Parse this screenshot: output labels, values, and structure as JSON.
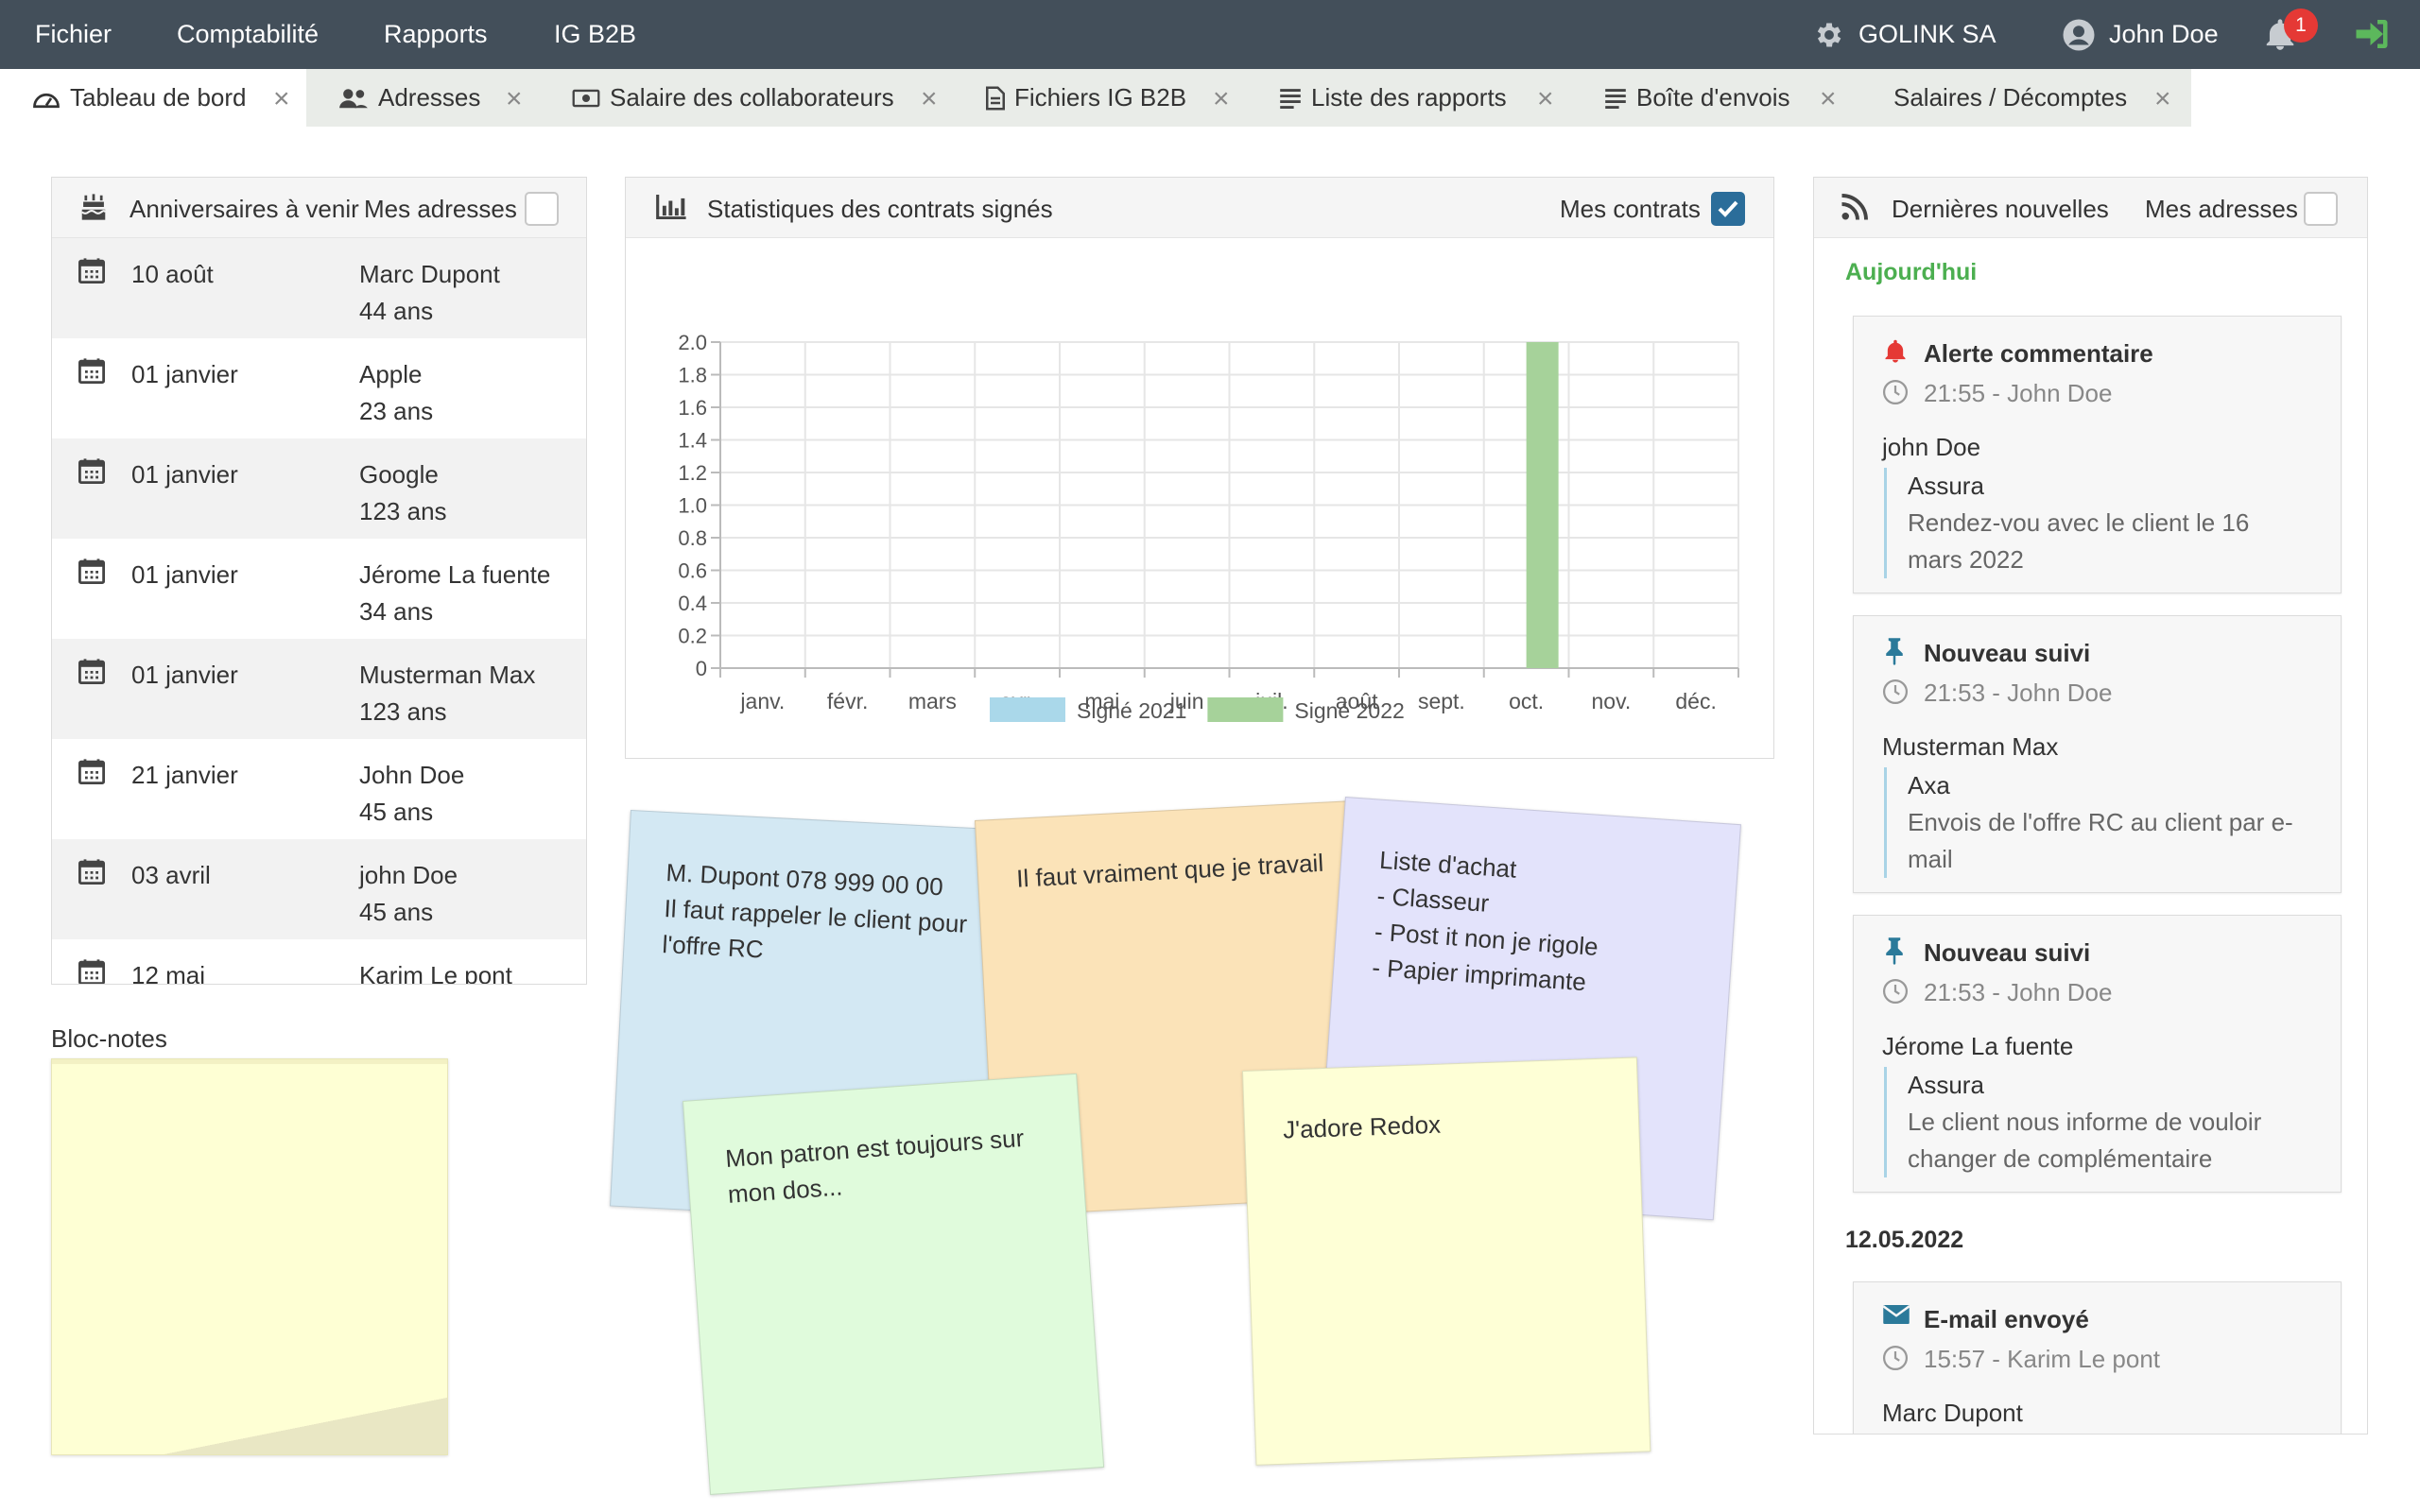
{
  "menu": {
    "items": [
      "Fichier",
      "Comptabilité",
      "Rapports",
      "IG B2B"
    ]
  },
  "header": {
    "company": "GOLINK SA",
    "user": "John Doe",
    "notifications_count": "1"
  },
  "tabs": [
    {
      "label": "Tableau de bord",
      "icon": "dashboard-icon",
      "active": true
    },
    {
      "label": "Adresses",
      "icon": "users-icon"
    },
    {
      "label": "Salaire des collaborateurs",
      "icon": "money-icon"
    },
    {
      "label": "Fichiers IG B2B",
      "icon": "file-icon"
    },
    {
      "label": "Liste des rapports",
      "icon": "list-icon"
    },
    {
      "label": "Boîte d'envois",
      "icon": "list-icon"
    },
    {
      "label": "Salaires / Décomptes",
      "icon": ""
    }
  ],
  "birthdays": {
    "title": "Anniversaires à venir",
    "filter_label": "Mes adresses",
    "filter_checked": false,
    "rows": [
      {
        "date": "10 août",
        "name": "Marc Dupont",
        "age": "44 ans"
      },
      {
        "date": "01 janvier",
        "name": "Apple",
        "age": "23 ans"
      },
      {
        "date": "01 janvier",
        "name": "Google",
        "age": "123 ans"
      },
      {
        "date": "01 janvier",
        "name": "Jérome La fuente",
        "age": "34 ans"
      },
      {
        "date": "01 janvier",
        "name": "Musterman Max",
        "age": "123 ans"
      },
      {
        "date": "21 janvier",
        "name": "John Doe",
        "age": "45 ans"
      },
      {
        "date": "03 avril",
        "name": "john Doe",
        "age": "45 ans"
      },
      {
        "date": "12 mai",
        "name": "Karim Le pont",
        "age": ""
      }
    ]
  },
  "notepad": {
    "title": "Bloc-notes",
    "content": ""
  },
  "stats": {
    "title": "Statistiques des contrats signés",
    "filter_label": "Mes contrats",
    "filter_checked": true
  },
  "chart_data": {
    "type": "bar",
    "categories": [
      "janv.",
      "févr.",
      "mars",
      "avr.",
      "mai",
      "juin",
      "juil.",
      "août",
      "sept.",
      "oct.",
      "nov.",
      "déc."
    ],
    "series": [
      {
        "name": "Signé 2021",
        "color": "#aad8ea",
        "values": [
          0,
          0,
          0,
          0,
          0,
          0,
          0,
          0,
          0,
          0,
          0,
          0
        ]
      },
      {
        "name": "Signé 2022",
        "color": "#a6d29a",
        "values": [
          0,
          0,
          0,
          0,
          0,
          0,
          0,
          0,
          0,
          2,
          0,
          0
        ]
      }
    ],
    "ylim": [
      0,
      2
    ],
    "yticks": [
      "0",
      "0.2",
      "0.4",
      "0.6",
      "0.8",
      "1.0",
      "1.2",
      "1.4",
      "1.6",
      "1.8",
      "2.0"
    ],
    "legend": "bottom",
    "grid": true
  },
  "notes": [
    {
      "lines": [
        "M. Dupont 078 999 00 00",
        "Il faut rappeler le client pour",
        "l'offre RC"
      ],
      "color": "#d3e8f3"
    },
    {
      "lines": [
        "Il faut vraiment que je travail"
      ],
      "color": "#fbe3b8"
    },
    {
      "lines": [
        "Liste d'achat",
        "- Classeur",
        "- Post it non je rigole",
        "- Papier imprimante"
      ],
      "color": "#e3e3fb"
    },
    {
      "lines": [
        "Mon patron est toujours sur",
        "mon dos..."
      ],
      "color": "#e0fbdc"
    },
    {
      "lines": [
        "J'adore Redox"
      ],
      "color": "#feffd6"
    }
  ],
  "news": {
    "title": "Dernières nouvelles",
    "filter_label": "Mes adresses",
    "filter_checked": false,
    "groups": [
      {
        "label": "Aujourd'hui",
        "items": [
          {
            "icon": "bell-icon",
            "title": "Alerte commentaire",
            "meta": "21:55 - John Doe",
            "who": "john Doe",
            "company": "Assura",
            "text": [
              "Rendez-vou avec le client le 16",
              "mars 2022"
            ]
          },
          {
            "icon": "pin-icon",
            "title": "Nouveau suivi",
            "meta": "21:53 - John Doe",
            "who": "Musterman Max",
            "company": "Axa",
            "text": [
              "Envois de l'offre RC au client par e-",
              "mail"
            ]
          },
          {
            "icon": "pin-icon",
            "title": "Nouveau suivi",
            "meta": "21:53 - John Doe",
            "who": "Jérome La fuente",
            "company": "Assura",
            "text": [
              "Le client nous informe de vouloir",
              "changer de complémentaire"
            ]
          }
        ]
      },
      {
        "label": "12.05.2022",
        "items": [
          {
            "icon": "envelope-icon",
            "title": "E-mail envoyé",
            "meta": "15:57 - Karim Le pont",
            "who": "Marc Dupont"
          }
        ]
      }
    ]
  },
  "colors": {
    "topbar": "#434f5a",
    "accent_green": "#4caf50",
    "logout_green": "#5cb85c",
    "badge_red": "#e53935",
    "checkbox_blue": "#2b6d9a"
  }
}
